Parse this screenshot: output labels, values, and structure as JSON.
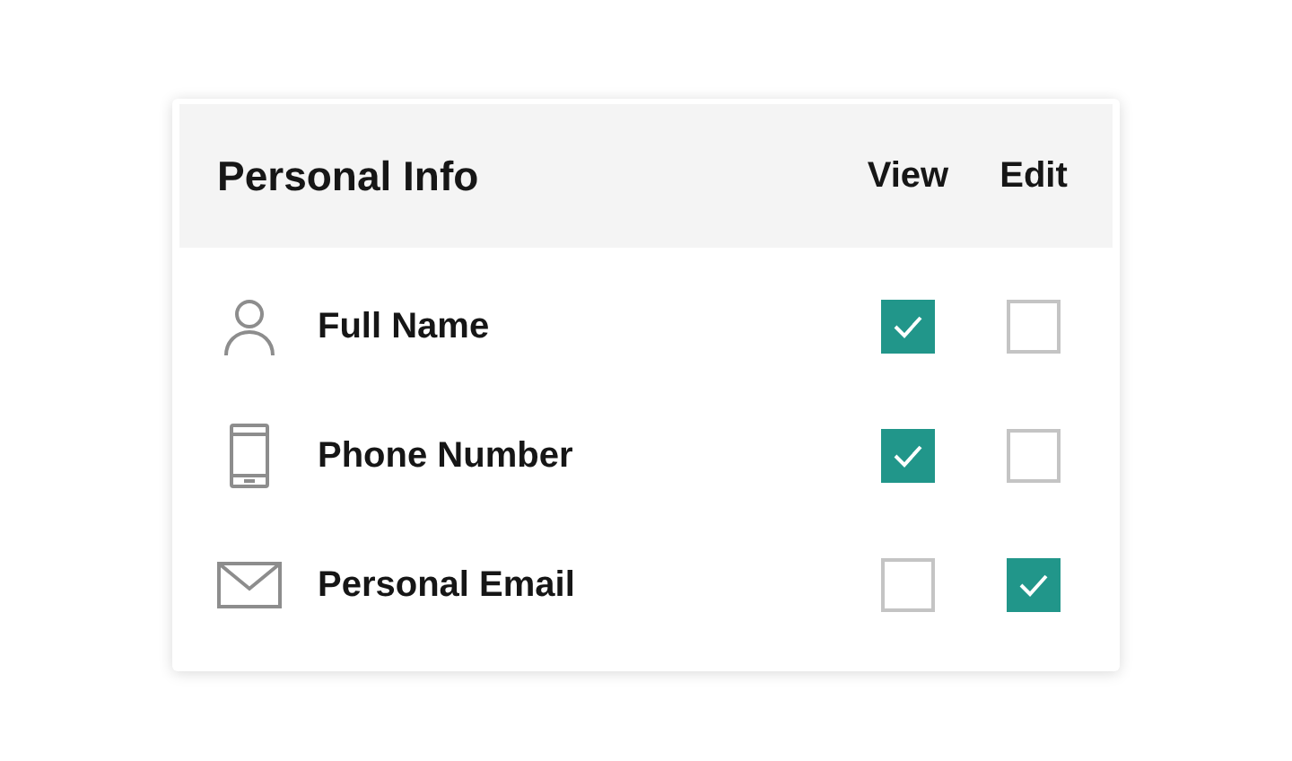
{
  "header": {
    "title": "Personal Info",
    "columns": [
      "View",
      "Edit"
    ]
  },
  "rows": [
    {
      "kind": "person",
      "label": "Full Name",
      "view": {
        "checked": true
      },
      "edit": {
        "checked": false
      }
    },
    {
      "kind": "phone",
      "label": "Phone Number",
      "view": {
        "checked": true
      },
      "edit": {
        "checked": false
      }
    },
    {
      "kind": "email",
      "label": "Personal Email",
      "view": {
        "checked": false
      },
      "edit": {
        "checked": true
      }
    }
  ]
}
